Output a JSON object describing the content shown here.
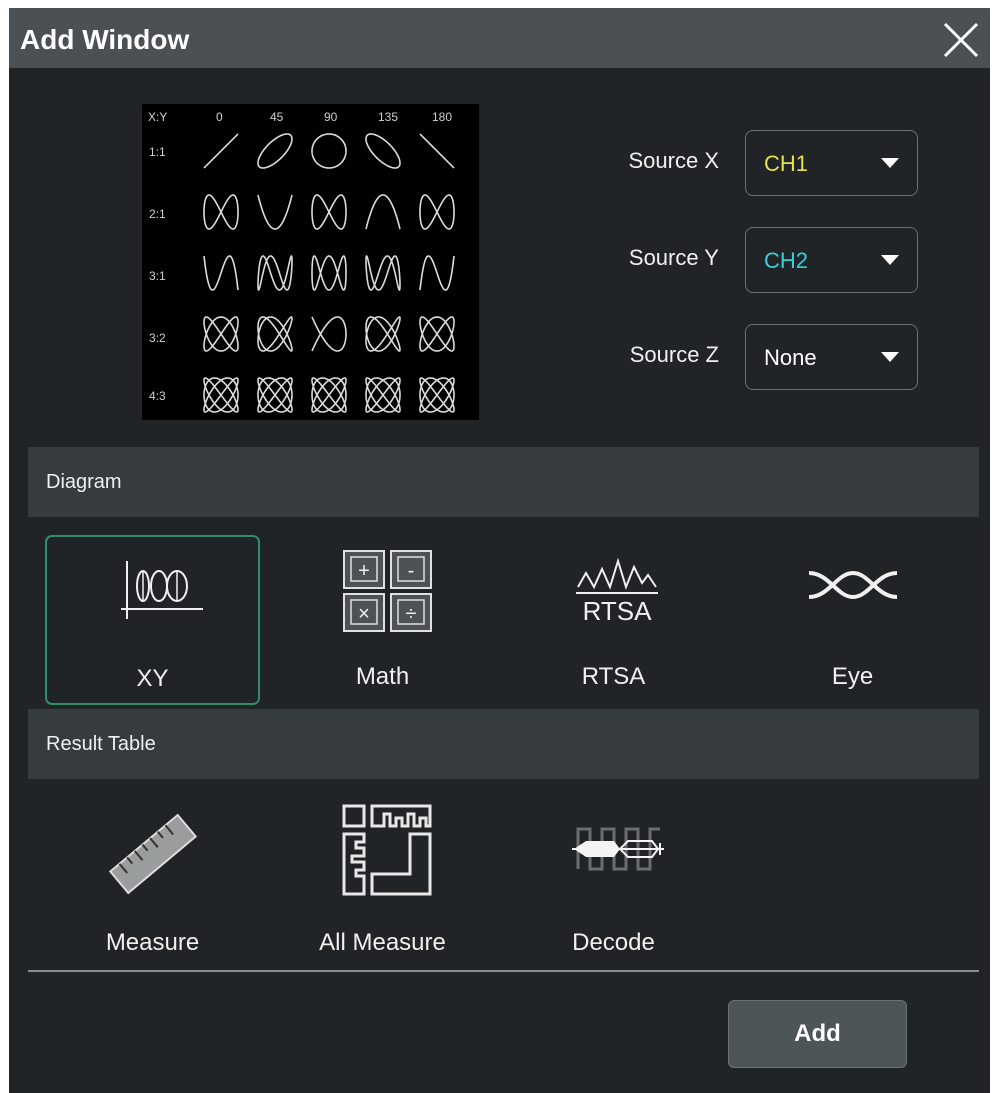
{
  "window": {
    "title": "Add Window",
    "close_icon": "close-icon"
  },
  "lissajous_reference": {
    "corner": "X:Y",
    "phase_labels": [
      "0",
      "45",
      "90",
      "135",
      "180"
    ],
    "ratio_labels": [
      "1:1",
      "2:1",
      "3:1",
      "3:2",
      "4:3"
    ]
  },
  "sources": [
    {
      "label": "Source X",
      "value": "CH1",
      "color": "#e6e04a"
    },
    {
      "label": "Source Y",
      "value": "CH2",
      "color": "#38d0d8"
    },
    {
      "label": "Source Z",
      "value": "None",
      "color": "#ffffff"
    }
  ],
  "diagram": {
    "section_label": "Diagram",
    "items": [
      {
        "label": "XY",
        "icon": "xy-icon",
        "selected": true
      },
      {
        "label": "Math",
        "icon": "math-icon",
        "icon_glyphs": [
          "+",
          "-",
          "×",
          "÷"
        ]
      },
      {
        "label": "RTSA",
        "icon": "rtsa-icon",
        "icon_text": "RTSA"
      },
      {
        "label": "Eye",
        "icon": "eye-diagram-icon"
      }
    ]
  },
  "result_table": {
    "section_label": "Result Table",
    "items": [
      {
        "label": "Measure",
        "icon": "ruler-icon"
      },
      {
        "label": "All Measure",
        "icon": "all-measure-icon"
      },
      {
        "label": "Decode",
        "icon": "decode-icon"
      }
    ]
  },
  "footer": {
    "add_label": "Add"
  },
  "colors": {
    "accent_selected": "#2e8e68",
    "background": "#202426",
    "titlebar": "#4a5053"
  }
}
